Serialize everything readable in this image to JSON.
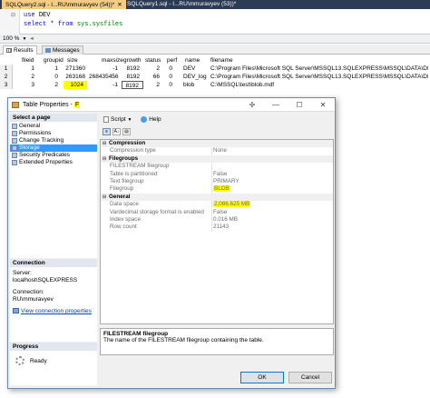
{
  "tabs": [
    {
      "label": "SQLQuery2.sql - I...RU\\mmuravyev (54))*",
      "active": true
    },
    {
      "label": "SQLQuery1.sql - I...RU\\mmuravyev (53))*",
      "active": false
    }
  ],
  "editor": {
    "line1": {
      "kw": "use",
      "ident": "DEV"
    },
    "line2": {
      "kw": "select",
      "mid": " * ",
      "kw2": "from",
      "obj": " sys.sysfiles"
    }
  },
  "zoom": "100 %",
  "result_tabs": [
    "Results",
    "Messages"
  ],
  "grid": {
    "headers": [
      "fileid",
      "groupid",
      "size",
      "maxsize",
      "growth",
      "status",
      "perf",
      "name",
      "filename"
    ],
    "rows": [
      [
        "1",
        "1",
        "1",
        "271360",
        "-1",
        "8192",
        "2",
        "0",
        "DEV",
        "C:\\Program Files\\Microsoft SQL Server\\MSSQL13.SQLEXPRESS\\MSSQL\\DATA\\DEV.mdf"
      ],
      [
        "2",
        "2",
        "0",
        "263168",
        "268435456",
        "8192",
        "66",
        "0",
        "DEV_log",
        "C:\\Program Files\\Microsoft SQL Server\\MSSQL13.SQLEXPRESS\\MSSQL\\DATA\\DEV_log.ldf"
      ],
      [
        "3",
        "3",
        "2",
        "1024",
        "-1",
        "8192",
        "2",
        "0",
        "blob",
        "C:\\MSSQL\\test\\blob.mdf"
      ]
    ]
  },
  "dialog": {
    "title": "Table Properties - ",
    "table_name": "F",
    "select_page_label": "Select a page",
    "pages": [
      "General",
      "Permissions",
      "Change Tracking",
      "Storage",
      "Security Predicates",
      "Extended Properties"
    ],
    "selected_page": "Storage",
    "toolbar": {
      "script": "Script",
      "help": "Help"
    },
    "properties": [
      {
        "type": "cat",
        "name": "Compression"
      },
      {
        "type": "prop",
        "name": "Compression type",
        "value": "None"
      },
      {
        "type": "cat",
        "name": "Filegroups"
      },
      {
        "type": "prop",
        "name": "FILESTREAM filegroup",
        "value": ""
      },
      {
        "type": "prop",
        "name": "Table is partitioned",
        "value": "False"
      },
      {
        "type": "prop",
        "name": "Text filegroup",
        "value": "PRIMARY"
      },
      {
        "type": "prop",
        "name": "Filegroup",
        "value": "BLOB",
        "hl": true
      },
      {
        "type": "cat",
        "name": "General"
      },
      {
        "type": "prop",
        "name": "Data space",
        "value": "2,086.625 MB",
        "hl": true
      },
      {
        "type": "prop",
        "name": "Vardecimal storage format is enabled",
        "value": "False"
      },
      {
        "type": "prop",
        "name": "Index space",
        "value": "0.016 MB"
      },
      {
        "type": "prop",
        "name": "Row count",
        "value": "21143"
      }
    ],
    "description": {
      "title": "FILESTREAM filegroup",
      "text": "The name of the FILESTREAM filegroup containing the table."
    },
    "connection": {
      "header": "Connection",
      "server_label": "Server:",
      "server": "localhost\\SQLEXPRESS",
      "conn_label": "Connection:",
      "conn": "RU\\mmuravyev",
      "link": "View connection properties"
    },
    "progress": {
      "header": "Progress",
      "status": "Ready"
    },
    "buttons": {
      "ok": "OK",
      "cancel": "Cancel"
    }
  }
}
